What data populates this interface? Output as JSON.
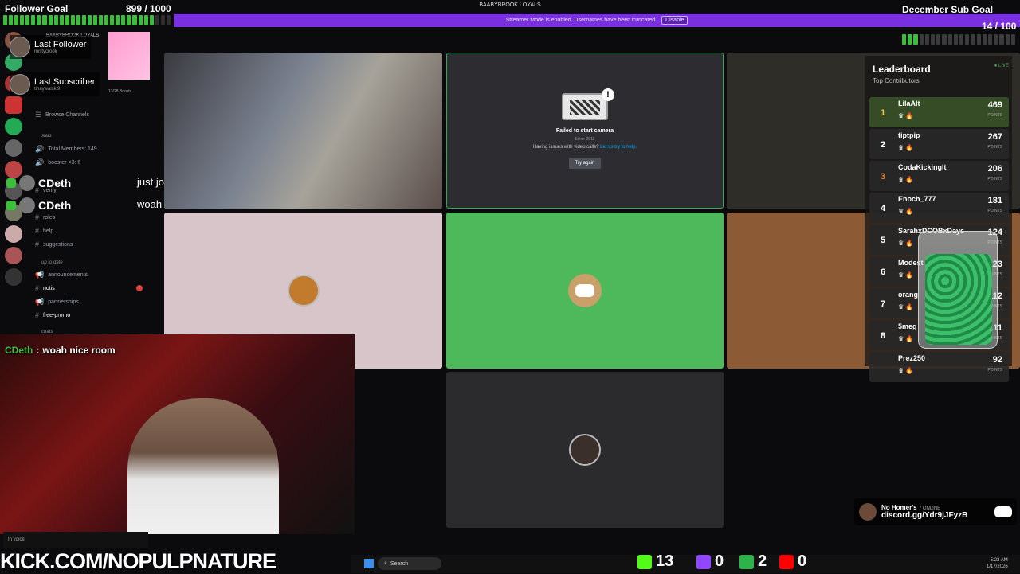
{
  "banner": {
    "server": "BAABYBROOK LOYALS",
    "text": "Streamer Mode is enabled. Usernames have been truncated.",
    "disable_label": "Disable"
  },
  "follower_goal": {
    "label": "Follower Goal",
    "count": "899 / 1000",
    "progress": 0.899
  },
  "sub_goal": {
    "label": "December Sub Goal",
    "count": "14 / 100",
    "progress": 0.14
  },
  "latest": {
    "follower_label": "Last Follower",
    "follower_name": "mistycrook",
    "subscriber_label": "Last Subscriber",
    "subscriber_name": "tinaywalski9"
  },
  "sidebar": {
    "server_name": "BAABYBROOK LOYALS",
    "boosts": "13/28 Boosts",
    "items": [
      {
        "type": "link",
        "label": "Browse Channels"
      },
      {
        "type": "category",
        "label": "stats"
      },
      {
        "type": "channel",
        "label": "Total Members: 149"
      },
      {
        "type": "channel",
        "label": "booster <3: 6"
      },
      {
        "type": "channel",
        "label": "verify"
      },
      {
        "type": "channel",
        "label": "roles"
      },
      {
        "type": "channel",
        "label": "help"
      },
      {
        "type": "channel",
        "label": "suggestions"
      },
      {
        "type": "category",
        "label": "up to date"
      },
      {
        "type": "channel",
        "label": "announcements"
      },
      {
        "type": "channel",
        "label": "notis",
        "badge": "2"
      },
      {
        "type": "channel",
        "label": "partnerships"
      },
      {
        "type": "channel",
        "label": "free-promo"
      },
      {
        "type": "category",
        "label": "chats"
      }
    ],
    "voice_status": "In voice"
  },
  "chat_overlay": [
    {
      "user": "CDeth",
      "message": "just joined channel!!"
    },
    {
      "user": "CDeth",
      "message": "woah nice room"
    }
  ],
  "cam_chat": {
    "user": "CDeth",
    "sep": ":",
    "message": "woah nice room"
  },
  "camera_fail": {
    "title": "Failed to start camera",
    "error": "Error: 2011",
    "help_prefix": "Having issues with video calls?",
    "help_link": "Let us try to help.",
    "button": "Try again"
  },
  "leaderboard": {
    "title": "Leaderboard",
    "subtitle": "Top Contributors",
    "live": "● LIVE",
    "points_label": "POINTS",
    "rows": [
      {
        "rank": "1",
        "name": "LilaAlt",
        "points": "469"
      },
      {
        "rank": "2",
        "name": "tiptpip",
        "points": "267"
      },
      {
        "rank": "3",
        "name": "CodaKickingIt",
        "points": "206"
      },
      {
        "rank": "4",
        "name": "Enoch_777",
        "points": "181"
      },
      {
        "rank": "5",
        "name": "SarahxDCOBxDays",
        "points": "124"
      },
      {
        "rank": "6",
        "name": "Modest",
        "points": "123"
      },
      {
        "rank": "7",
        "name": "orang",
        "points": "112"
      },
      {
        "rank": "8",
        "name": "5meg",
        "points": "111"
      },
      {
        "rank": "",
        "name": "Prez250",
        "points": "92"
      }
    ]
  },
  "invite": {
    "title": "No Homer's",
    "online": "7 ONLINE",
    "link": "discord.gg/Ydr9jJFyzB"
  },
  "bottom": {
    "kick_url": "KICK.COM/NOPULPNATURE",
    "search": "Search",
    "kick_count": "13",
    "twitch_count": "0",
    "kick2_count": "2",
    "youtube_count": "0",
    "time": "5:23 AM",
    "date": "1/17/2026"
  },
  "colors": {
    "accent": "#7a2fe0",
    "goal_green": "#3bbf3b",
    "discord_green": "#4db95b",
    "kick_green": "#53fc18",
    "twitch": "#9146ff",
    "youtube": "#ff0000"
  }
}
